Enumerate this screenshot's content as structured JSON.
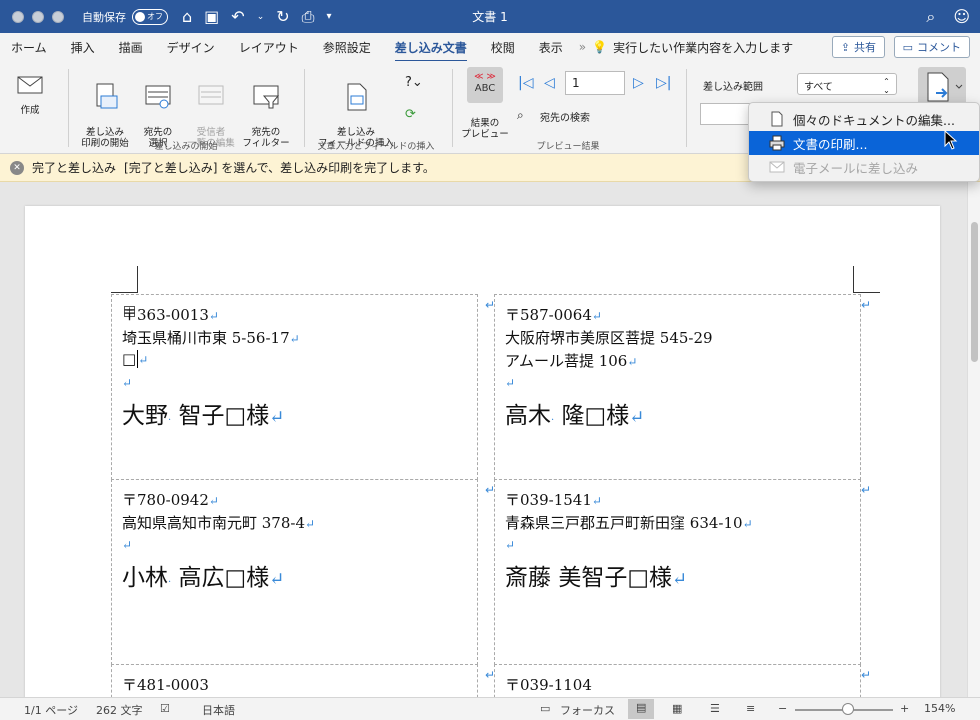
{
  "titlebar": {
    "autosave_label": "自動保存",
    "toggle_state": "オフ",
    "title": "文書 1"
  },
  "tabs": [
    "ホーム",
    "挿入",
    "描画",
    "デザイン",
    "レイアウト",
    "参照設定",
    "差し込み文書",
    "校閲",
    "表示"
  ],
  "active_tab": "差し込み文書",
  "tell_me": "実行したい作業内容を入力します",
  "share_label": "共有",
  "comment_label": "コメント",
  "ribbon": {
    "create": "作成",
    "start_merge": "差し込み\n印刷の開始",
    "select_recipients": "宛先の\n選択",
    "edit_recipients": "受信者\n一覧の編集",
    "filter_recipients": "宛先の\nフィルター",
    "group_start": "差し込みの開始",
    "insert_field": "差し込み\nフィールドの挿入",
    "group_insert": "文章入力とフィールドの挿入",
    "preview_results": "結果の\nプレビュー",
    "find_recipient": "宛先の検索",
    "group_preview": "プレビュー結果",
    "record_number": "1",
    "abc_label": "ABC",
    "merge_range_label": "差し込み範囲",
    "merge_range_value": "すべて"
  },
  "dropdown": {
    "items": [
      {
        "label": "個々のドキュメントの編集...",
        "state": "normal"
      },
      {
        "label": "文書の印刷...",
        "state": "selected"
      },
      {
        "label": "電子メールに差し込み",
        "state": "disabled"
      }
    ]
  },
  "infobar": {
    "title": "完了と差し込み",
    "message": "[完了と差し込み] を選んで、差し込み印刷を完了します。"
  },
  "labels": [
    {
      "zip": "〒363-0013",
      "address1": "埼玉県桶川市東 5-56-17",
      "address2": "□",
      "last": "大野",
      "first": "智子",
      "suffix": "□様"
    },
    {
      "zip": "〒587-0064",
      "address1": "大阪府堺市美原区菩提 545-29",
      "address2": "アムール菩提 106",
      "last": "高木",
      "first": "隆",
      "suffix": "□様"
    },
    {
      "zip": "〒780-0942",
      "address1": "高知県高知市南元町 378-4",
      "address2": "",
      "last": "小林",
      "first": "高広",
      "suffix": "□様"
    },
    {
      "zip": "〒039-1541",
      "address1": "青森県三戸郡五戸町新田窪 634-10",
      "address2": "",
      "last": "斎藤",
      "first": "美智子",
      "suffix": "□様"
    },
    {
      "zip": "〒481-0003"
    },
    {
      "zip": "〒039-1104"
    }
  ],
  "statusbar": {
    "page": "1/1 ページ",
    "words": "262 文字",
    "language": "日本語",
    "focus": "フォーカス",
    "zoom": "154%"
  },
  "colors": {
    "title_blue": "#2b579a",
    "selection_blue": "#0a64d8",
    "para_mark": "#3a8ad8",
    "infobar_bg": "#fdf3d4"
  }
}
